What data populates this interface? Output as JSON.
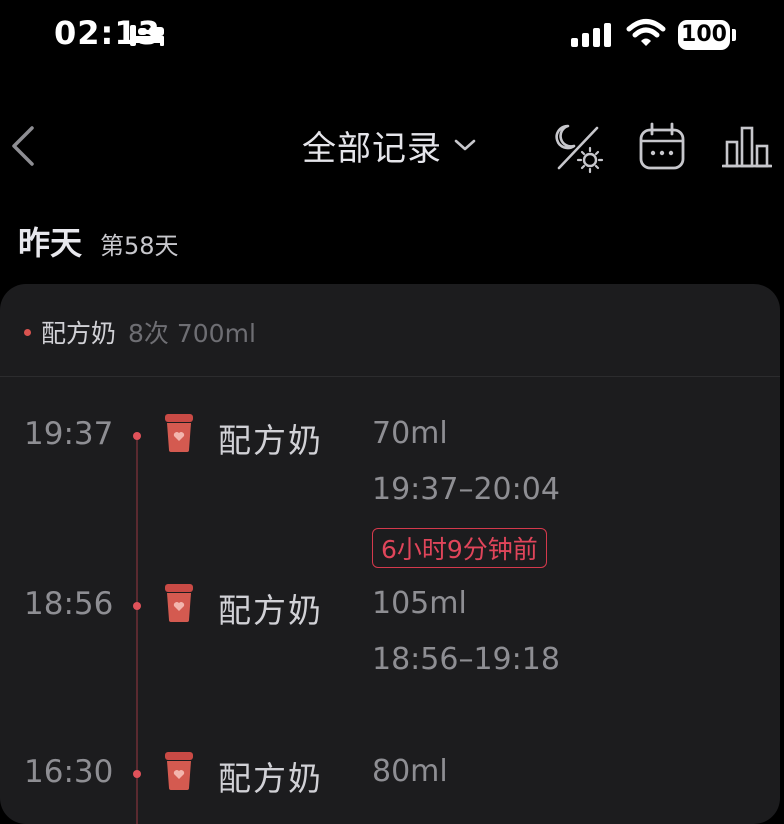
{
  "status_bar": {
    "time": "02:13",
    "battery": "100"
  },
  "nav": {
    "title": "全部记录"
  },
  "day": {
    "label": "昨天",
    "count": "第58天"
  },
  "summary": {
    "name": "配方奶",
    "detail": "8次 700ml"
  },
  "entries": [
    {
      "time": "19:37",
      "name": "配方奶",
      "amount": "70ml",
      "range": "19:37–20:04",
      "ago": "6小时9分钟前"
    },
    {
      "time": "18:56",
      "name": "配方奶",
      "amount": "105ml",
      "range": "18:56–19:18"
    },
    {
      "time": "16:30",
      "name": "配方奶",
      "amount": "80ml"
    }
  ],
  "colors": {
    "accent": "#e0455a",
    "background": "#000000",
    "card": "#1c1c1e"
  },
  "icons": [
    "back-arrow-icon",
    "chevron-down-icon",
    "day-night-icon",
    "calendar-icon",
    "bar-chart-icon",
    "bottle-icon",
    "bed-icon",
    "signal-icon",
    "wifi-icon",
    "battery-icon"
  ]
}
